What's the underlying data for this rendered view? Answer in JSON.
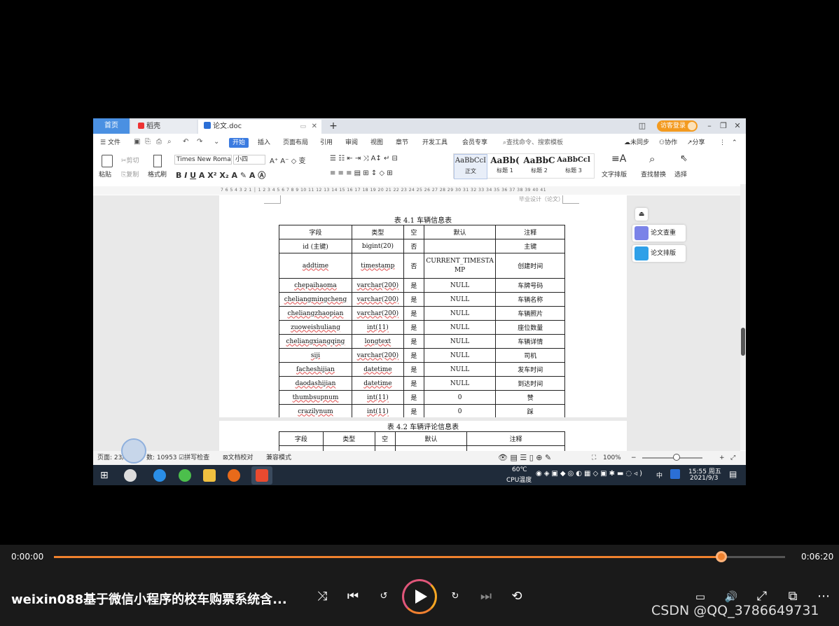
{
  "screen": {
    "tabs": {
      "home": "首页",
      "draft": "稻壳",
      "doc": "论文.doc",
      "add": "+"
    },
    "login": "访客登录",
    "menu": [
      "文件",
      "开始",
      "插入",
      "页面布局",
      "引用",
      "审阅",
      "视图",
      "章节",
      "开发工具",
      "会员专享"
    ],
    "menu_active": "开始",
    "search": "查找命令、搜索模板",
    "right_menu": [
      "未同步",
      "协作",
      "分享"
    ],
    "ribbon": {
      "paste": "粘贴",
      "cut": "剪切",
      "copy": "复制",
      "format_painter": "格式刷",
      "font_name": "Times New Roma",
      "font_size": "小四",
      "styles": [
        {
          "sample": "AaBbCcI",
          "name": "正文"
        },
        {
          "sample": "AaBb(",
          "name": "标题 1"
        },
        {
          "sample": "AaBbC",
          "name": "标题 2"
        },
        {
          "sample": "AaBbCcl",
          "name": "标题 3"
        }
      ],
      "text_layout": "文字排版",
      "find_replace": "查找替换",
      "select": "选择"
    },
    "ruler": "7 6 5 4 3 2 1 │ 1 2 3 4 5 6 7 8 9 10 11 12 13 14 15 16 17 18 19 20 21 22 23 24 25 26 27 28 29 30 31 32 33 34 35 36 37 38 39 40 41",
    "page_header": "毕业设计（论文）",
    "table1": {
      "caption": "表 4.1  车辆信息表",
      "headers": [
        "字段",
        "类型",
        "空",
        "默认",
        "注释"
      ],
      "rows": [
        [
          "id (主键)",
          "bigint(20)",
          "否",
          "",
          "主键"
        ],
        [
          "addtime",
          "timestamp",
          "否",
          "CURRENT_TIMESTAMP",
          "创建时间"
        ],
        [
          "chepaihaoma",
          "varchar(200)",
          "是",
          "NULL",
          "车牌号码"
        ],
        [
          "cheliangmingcheng",
          "varchar(200)",
          "是",
          "NULL",
          "车辆名称"
        ],
        [
          "cheliangzhaopian",
          "varchar(200)",
          "是",
          "NULL",
          "车辆照片"
        ],
        [
          "zuoweishuliang",
          "int(11)",
          "是",
          "NULL",
          "座位数量"
        ],
        [
          "cheliangxiangqing",
          "longtext",
          "是",
          "NULL",
          "车辆详情"
        ],
        [
          "siji",
          "varchar(200)",
          "是",
          "NULL",
          "司机"
        ],
        [
          "facheshijian",
          "datetime",
          "是",
          "NULL",
          "发车时间"
        ],
        [
          "daodashijian",
          "datetime",
          "是",
          "NULL",
          "到达时间"
        ],
        [
          "thumbsupnum",
          "int(11)",
          "是",
          "0",
          "赞"
        ],
        [
          "crazilynum",
          "int(11)",
          "是",
          "0",
          "踩"
        ]
      ]
    },
    "table2": {
      "caption": "表 4.2  车辆评论信息表",
      "headers": [
        "字段",
        "类型",
        "空",
        "默认",
        "注释"
      ]
    },
    "side_panel": [
      "论文查重",
      "论文排版"
    ],
    "status": {
      "page": "页面: 23/",
      "words": "数: 10953",
      "spell": "拼写检查",
      "proof": "文档校对",
      "compat": "兼容模式",
      "zoom": "100%"
    },
    "taskbar": {
      "temp": "60℃",
      "cpu": "CPU温度",
      "ime": "中",
      "time": "15:55 周五",
      "date": "2021/9/3"
    }
  },
  "player": {
    "current_time": "0:00:00",
    "total_time": "0:06:20",
    "progress": 0.915,
    "title": "weixin088基于微信小程序的校车购票系统含...",
    "watermark": "CSDN @QQ_3786649731",
    "colors": {
      "accent": "#f0822e"
    }
  }
}
